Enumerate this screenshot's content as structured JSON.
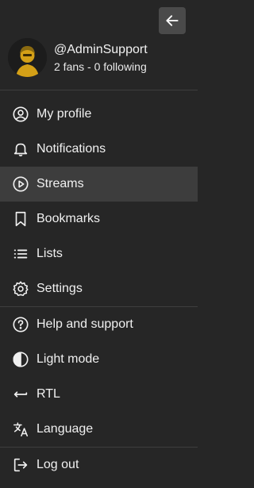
{
  "header": {
    "back_button_icon": "arrow-left-icon"
  },
  "user": {
    "handle": "@AdminSupport",
    "stats": "2 fans - 0 following",
    "avatar_icon": "user-avatar-icon"
  },
  "menu_primary": [
    {
      "label": "My profile",
      "icon": "user-circle-icon"
    },
    {
      "label": "Notifications",
      "icon": "bell-icon"
    },
    {
      "label": "Streams",
      "icon": "play-circle-icon",
      "active": true
    },
    {
      "label": "Bookmarks",
      "icon": "bookmark-icon"
    },
    {
      "label": "Lists",
      "icon": "list-icon"
    },
    {
      "label": "Settings",
      "icon": "gear-icon"
    }
  ],
  "menu_secondary": [
    {
      "label": "Help and support",
      "icon": "question-circle-icon"
    },
    {
      "label": "Light mode",
      "icon": "half-circle-icon"
    },
    {
      "label": "RTL",
      "icon": "return-arrow-icon"
    },
    {
      "label": "Language",
      "icon": "translate-icon"
    }
  ],
  "menu_footer": [
    {
      "label": "Log out",
      "icon": "logout-icon"
    }
  ],
  "colors": {
    "background": "#262626",
    "active_row": "#3d3d3d",
    "divider": "#3e3e3e",
    "text": "#f0f0f0",
    "avatar_accent": "#d4a017"
  }
}
